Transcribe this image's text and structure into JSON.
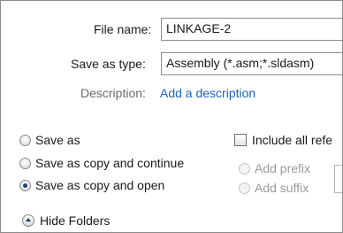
{
  "file_name": {
    "label": "File name:",
    "value": "LINKAGE-2"
  },
  "save_as_type": {
    "label": "Save as type:",
    "value": "Assembly (*.asm;*.sldasm)"
  },
  "description": {
    "label": "Description:",
    "link": "Add a description"
  },
  "save_options": [
    {
      "label": "Save as",
      "checked": false
    },
    {
      "label": "Save as copy and continue",
      "checked": false
    },
    {
      "label": "Save as copy and open",
      "checked": true
    }
  ],
  "include_references": {
    "label": "Include all refe",
    "checked": false
  },
  "prefix_suffix": [
    {
      "label": "Add prefix"
    },
    {
      "label": "Add suffix"
    }
  ],
  "hide_folders": {
    "label": "Hide Folders",
    "icon": "chevron-up-icon"
  },
  "colors": {
    "link": "#1a64b9",
    "selected_radio": "#1f3f8a",
    "disabled_text": "#9a9a9a"
  }
}
